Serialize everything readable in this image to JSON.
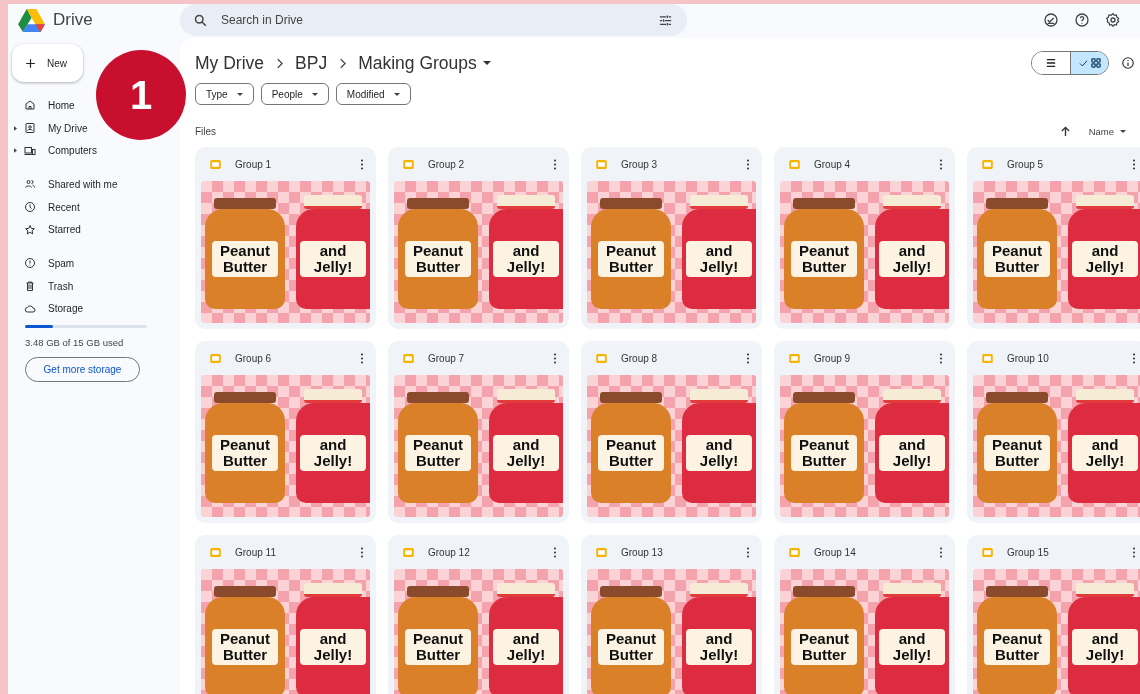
{
  "app": {
    "name": "Drive"
  },
  "search": {
    "placeholder": "Search in Drive"
  },
  "new_button": "New",
  "nav_groups": [
    [
      {
        "label": "Home",
        "kind": "home",
        "expandable": false
      },
      {
        "label": "My Drive",
        "kind": "drive",
        "expandable": true
      },
      {
        "label": "Computers",
        "kind": "computer",
        "expandable": true
      }
    ],
    [
      {
        "label": "Shared with me",
        "kind": "people",
        "expandable": false
      },
      {
        "label": "Recent",
        "kind": "clock",
        "expandable": false
      },
      {
        "label": "Starred",
        "kind": "star",
        "expandable": false
      }
    ],
    [
      {
        "label": "Spam",
        "kind": "spam",
        "expandable": false
      },
      {
        "label": "Trash",
        "kind": "trash",
        "expandable": false
      },
      {
        "label": "Storage",
        "kind": "cloud",
        "expandable": false
      }
    ]
  ],
  "storage": {
    "level": 0.23,
    "text": "3.48 GB of 15 GB used",
    "button": "Get more storage"
  },
  "breadcrumb": [
    "My Drive",
    "BPJ",
    "Making Groups"
  ],
  "filters": [
    "Type",
    "People",
    "Modified"
  ],
  "view_toggle": [
    {
      "kind": "list",
      "selected": false
    },
    {
      "kind": "grid",
      "selected": true
    }
  ],
  "section": "Files",
  "sort": {
    "label": "Name"
  },
  "files": [
    {
      "name": "Group 1",
      "thumb_left": "Peanut Butter",
      "thumb_right": "and Jelly!"
    },
    {
      "name": "Group 2",
      "thumb_left": "Peanut Butter",
      "thumb_right": "and Jelly!"
    },
    {
      "name": "Group 3",
      "thumb_left": "Peanut Butter",
      "thumb_right": "and Jelly!"
    },
    {
      "name": "Group 4",
      "thumb_left": "Peanut Butter",
      "thumb_right": "and Jelly!"
    },
    {
      "name": "Group 5",
      "thumb_left": "Peanut Butter",
      "thumb_right": "and Jelly!"
    },
    {
      "name": "Group 6",
      "thumb_left": "Peanut Butter",
      "thumb_right": "and Jelly!"
    },
    {
      "name": "Group 7",
      "thumb_left": "Peanut Butter",
      "thumb_right": "and Jelly!"
    },
    {
      "name": "Group 8",
      "thumb_left": "Peanut Butter",
      "thumb_right": "and Jelly!"
    },
    {
      "name": "Group 9",
      "thumb_left": "Peanut Butter",
      "thumb_right": "and Jelly!"
    },
    {
      "name": "Group 10",
      "thumb_left": "Peanut Butter",
      "thumb_right": "and Jelly!"
    },
    {
      "name": "Group 11",
      "thumb_left": "Peanut Butter",
      "thumb_right": "and Jelly!"
    },
    {
      "name": "Group 12",
      "thumb_left": "Peanut Butter",
      "thumb_right": "and Jelly!"
    },
    {
      "name": "Group 13",
      "thumb_left": "Peanut Butter",
      "thumb_right": "and Jelly!"
    },
    {
      "name": "Group 14",
      "thumb_left": "Peanut Butter",
      "thumb_right": "and Jelly!"
    },
    {
      "name": "Group 15",
      "thumb_left": "Peanut Butter",
      "thumb_right": "and Jelly!"
    }
  ],
  "badge": "1"
}
